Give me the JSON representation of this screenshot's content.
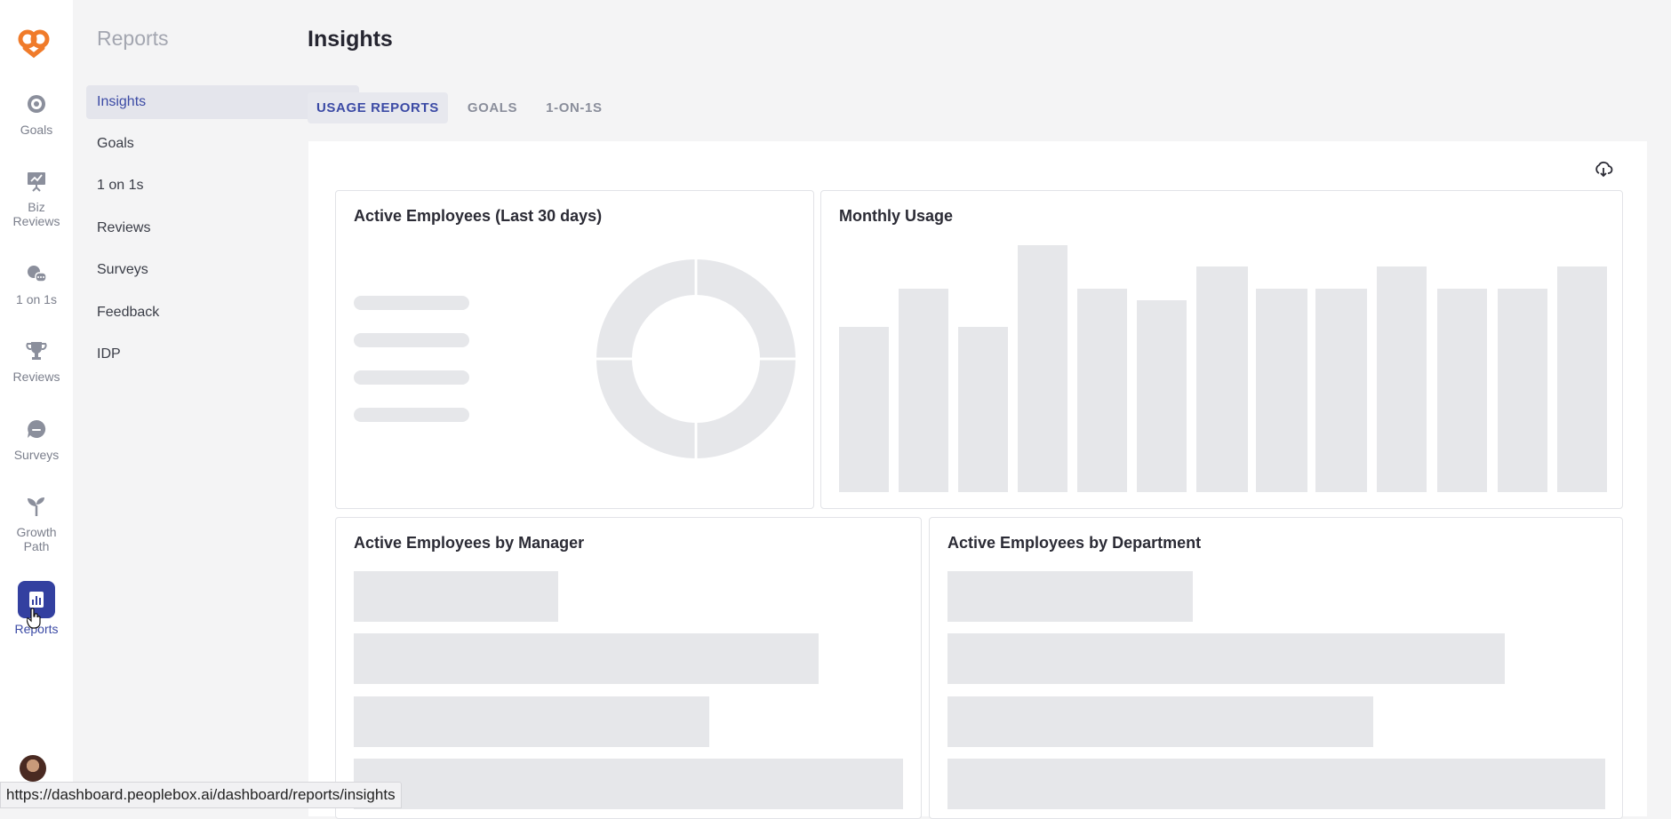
{
  "rail": {
    "items": [
      {
        "label": "Goals",
        "icon": "target-icon"
      },
      {
        "label": "Biz Reviews",
        "icon": "presentation-icon"
      },
      {
        "label": "1 on 1s",
        "icon": "chat-bubbles-icon"
      },
      {
        "label": "Reviews",
        "icon": "trophy-icon"
      },
      {
        "label": "Surveys",
        "icon": "speech-bubble-icon"
      },
      {
        "label": "Growth Path",
        "icon": "sprout-icon"
      },
      {
        "label": "Reports",
        "icon": "bar-chart-icon"
      }
    ]
  },
  "subnav": {
    "title": "Reports",
    "items": [
      "Insights",
      "Goals",
      "1 on 1s",
      "Reviews",
      "Surveys",
      "Feedback",
      "IDP"
    ]
  },
  "main": {
    "title": "Insights",
    "tabs": [
      "USAGE REPORTS",
      "GOALS",
      "1-ON-1S"
    ]
  },
  "cards": {
    "active_employees": "Active Employees (Last 30 days)",
    "monthly_usage": "Monthly Usage",
    "by_manager": "Active Employees by Manager",
    "by_department": "Active Employees by Department"
  },
  "status_url": "https://dashboard.peoplebox.ai/dashboard/reports/insights",
  "colors": {
    "accent": "#3b4aa5",
    "logo": "#f07b2a",
    "skeleton": "#e6e7ea"
  }
}
